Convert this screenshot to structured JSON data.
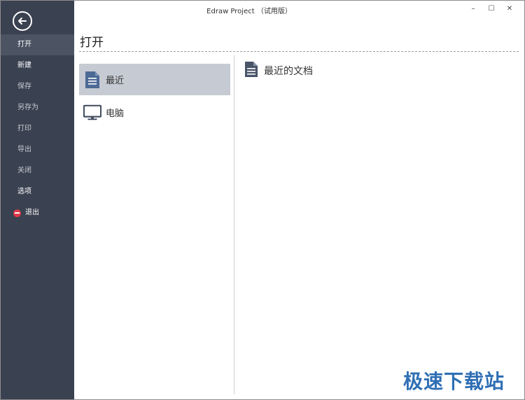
{
  "window": {
    "title": "Edraw Project （试用版）"
  },
  "controls": {
    "minimize": "–",
    "maximize": "☐",
    "close": "✕"
  },
  "sidebar": {
    "items": [
      {
        "label": "打开"
      },
      {
        "label": "新建"
      },
      {
        "label": "保存"
      },
      {
        "label": "另存为"
      },
      {
        "label": "打印"
      },
      {
        "label": "导出"
      },
      {
        "label": "关闭"
      },
      {
        "label": "选项"
      },
      {
        "label": "退出"
      }
    ]
  },
  "page": {
    "title": "打开"
  },
  "open_locations": [
    {
      "label": "最近",
      "icon": "document-icon"
    },
    {
      "label": "电脑",
      "icon": "monitor-icon"
    }
  ],
  "recent": {
    "header": "最近的文档"
  },
  "watermark": "极速下载站",
  "colors": {
    "sidebar": "#3a4150",
    "active_item": "#c6cad2",
    "watermark": "#2f6fb4"
  }
}
